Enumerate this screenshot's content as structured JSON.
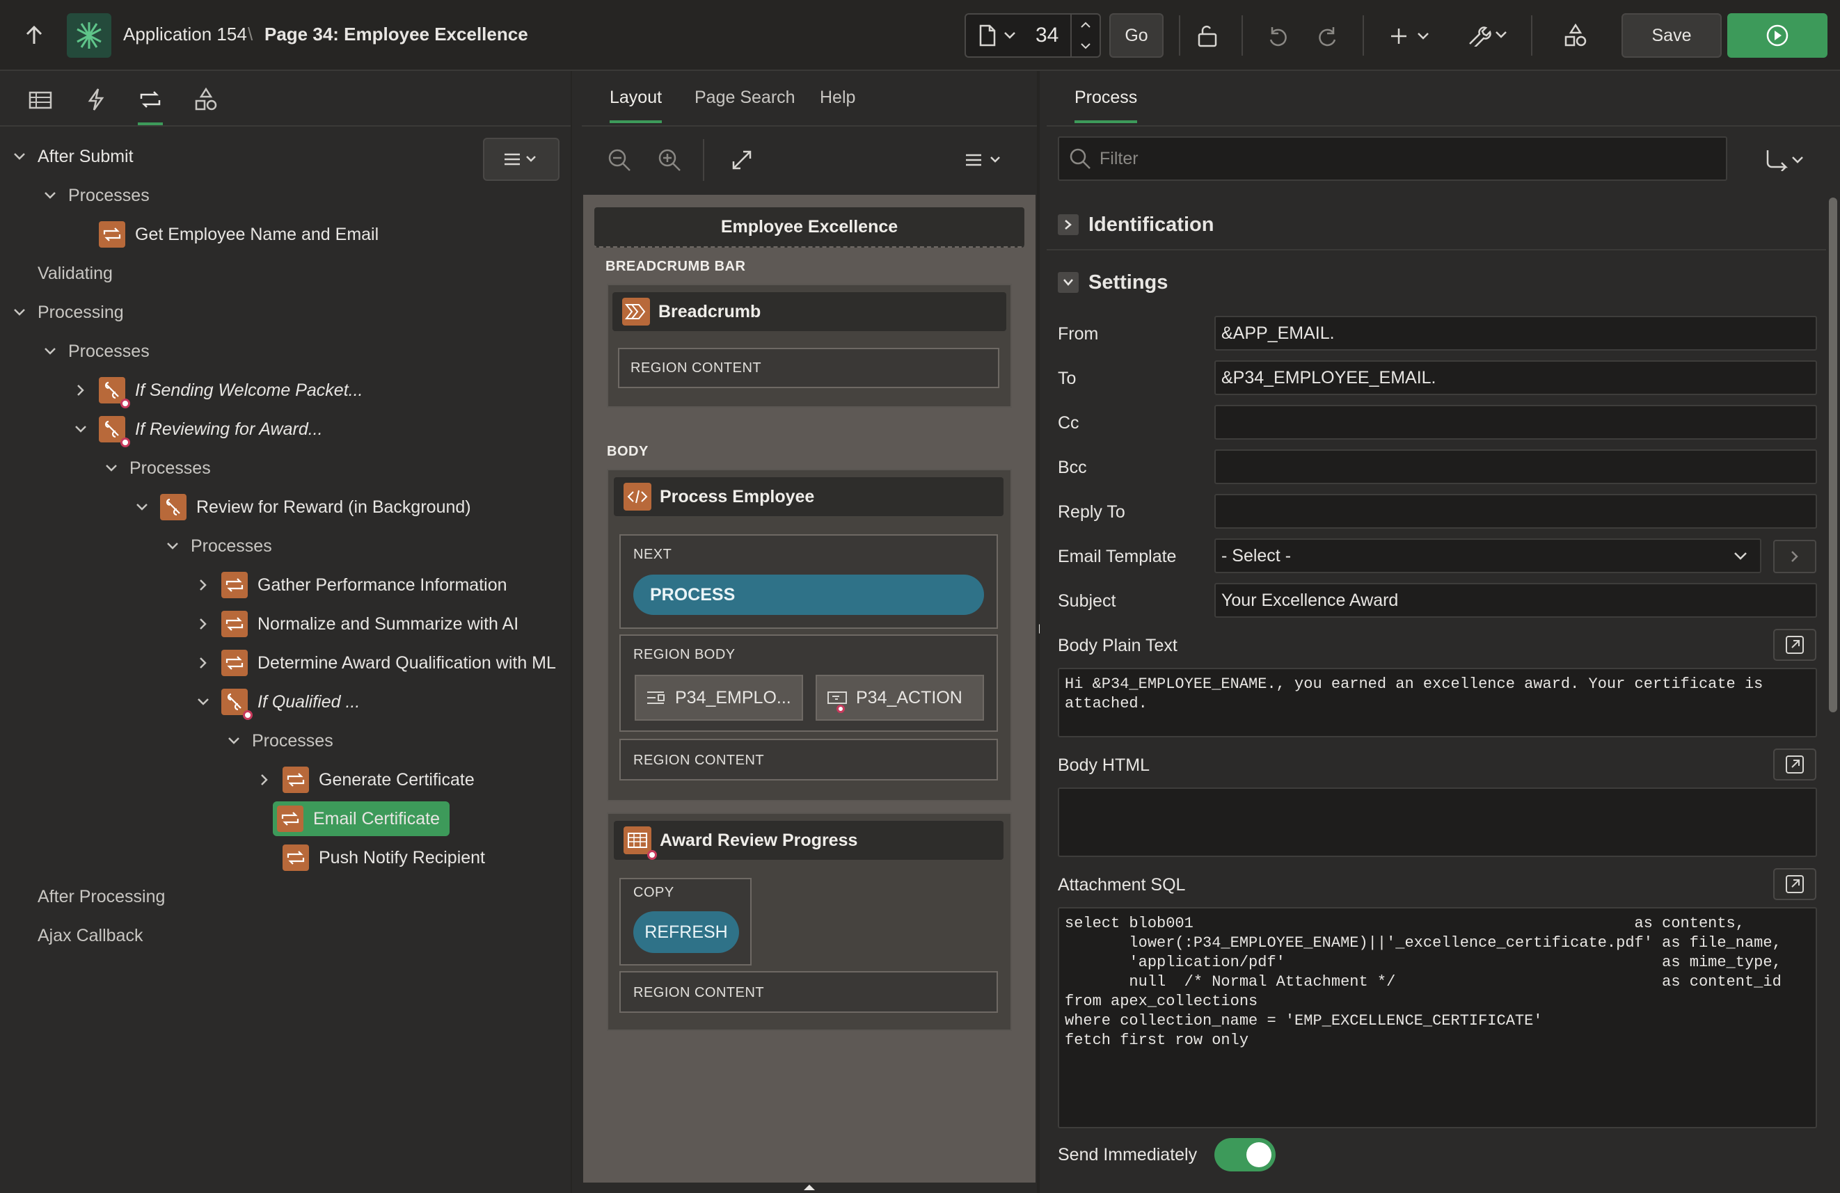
{
  "header": {
    "app_label": "Application 154",
    "separator": "\\",
    "page_label": "Page 34: Employee Excellence",
    "page_number": "34",
    "go_label": "Go",
    "save_label": "Save"
  },
  "left_tree": [
    {
      "label": "After Submit",
      "level": 0,
      "chevron": "down",
      "icon": "none",
      "style": "normal"
    },
    {
      "label": "Processes",
      "level": 1,
      "chevron": "down",
      "icon": "none",
      "style": "gray"
    },
    {
      "label": "Get Employee Name and Email",
      "level": 2,
      "chevron": "none",
      "icon": "process",
      "style": "normal"
    },
    {
      "label": "Validating",
      "level": 0,
      "chevron": "none",
      "icon": "none",
      "style": "gray"
    },
    {
      "label": "Processing",
      "level": 0,
      "chevron": "down",
      "icon": "none",
      "style": "gray"
    },
    {
      "label": "Processes",
      "level": 1,
      "chevron": "down",
      "icon": "none",
      "style": "gray"
    },
    {
      "label": "If Sending Welcome Packet...",
      "level": 2,
      "chevron": "right",
      "icon": "branch",
      "style": "italic"
    },
    {
      "label": "If Reviewing for Award...",
      "level": 2,
      "chevron": "down",
      "icon": "branch",
      "style": "italic"
    },
    {
      "label": "Processes",
      "level": 3,
      "chevron": "down",
      "icon": "none",
      "style": "gray"
    },
    {
      "label": "Review for Reward (in Background)",
      "level": 4,
      "chevron": "down",
      "icon": "background",
      "style": "normal"
    },
    {
      "label": "Processes",
      "level": 5,
      "chevron": "down",
      "icon": "none",
      "style": "gray"
    },
    {
      "label": "Gather Performance Information",
      "level": 6,
      "chevron": "right",
      "icon": "process",
      "style": "normal"
    },
    {
      "label": "Normalize and Summarize with AI",
      "level": 6,
      "chevron": "right",
      "icon": "process",
      "style": "normal"
    },
    {
      "label": "Determine Award Qualification with ML",
      "level": 6,
      "chevron": "right",
      "icon": "process",
      "style": "normal"
    },
    {
      "label": "If Qualified ...",
      "level": 6,
      "chevron": "down",
      "icon": "branch",
      "style": "italic"
    },
    {
      "label": "Processes",
      "level": 7,
      "chevron": "down",
      "icon": "none",
      "style": "gray"
    },
    {
      "label": "Generate Certificate",
      "level": 8,
      "chevron": "right",
      "icon": "process",
      "style": "normal"
    },
    {
      "label": "Email Certificate",
      "level": 8,
      "chevron": "none",
      "icon": "process",
      "style": "selected"
    },
    {
      "label": "Push Notify Recipient",
      "level": 8,
      "chevron": "none",
      "icon": "process",
      "style": "normal"
    },
    {
      "label": "After Processing",
      "level": 0,
      "chevron": "none",
      "icon": "none",
      "style": "gray"
    },
    {
      "label": "Ajax Callback",
      "level": 0,
      "chevron": "none",
      "icon": "none",
      "style": "gray"
    }
  ],
  "middle": {
    "tabs": [
      "Layout",
      "Page Search",
      "Help"
    ],
    "page_title": "Employee Excellence",
    "breadcrumb_bar_label": "BREADCRUMB BAR",
    "breadcrumb_title": "Breadcrumb",
    "region_content": "REGION CONTENT",
    "body_label": "BODY",
    "process_employee_title": "Process Employee",
    "next_label": "NEXT",
    "process_button": "PROCESS",
    "region_body_label": "REGION BODY",
    "item1": "P34_EMPLO...",
    "item2": "P34_ACTION",
    "award_title": "Award Review Progress",
    "copy_label": "COPY",
    "refresh_button": "REFRESH"
  },
  "right": {
    "tab": "Process",
    "filter_placeholder": "Filter",
    "identification": "Identification",
    "settings": "Settings",
    "labels": {
      "from": "From",
      "to": "To",
      "cc": "Cc",
      "bcc": "Bcc",
      "reply_to": "Reply To",
      "email_template": "Email Template",
      "subject": "Subject",
      "body_plain": "Body Plain Text",
      "body_html": "Body HTML",
      "attachment_sql": "Attachment SQL",
      "send_immediately": "Send Immediately"
    },
    "values": {
      "from": "&APP_EMAIL.",
      "to": "&P34_EMPLOYEE_EMAIL.",
      "cc": "",
      "bcc": "",
      "reply_to": "",
      "email_template": "- Select -",
      "subject": "Your Excellence Award",
      "body_plain": "Hi &P34_EMPLOYEE_ENAME., you earned an excellence award. Your certificate is\nattached.",
      "body_html": "",
      "attachment_sql": "select blob001                                                as contents,\n       lower(:P34_EMPLOYEE_ENAME)||'_excellence_certificate.pdf' as file_name,\n       'application/pdf'                                         as mime_type,\n       null  /* Normal Attachment */                             as content_id\nfrom apex_collections\nwhere collection_name = 'EMP_EXCELLENCE_CERTIFICATE'\nfetch first row only",
      "send_immediately": true
    },
    "colors": {
      "accent": "#3d9a5a",
      "process_icon": "#b8693a",
      "button_teal": "#2f7288"
    }
  }
}
